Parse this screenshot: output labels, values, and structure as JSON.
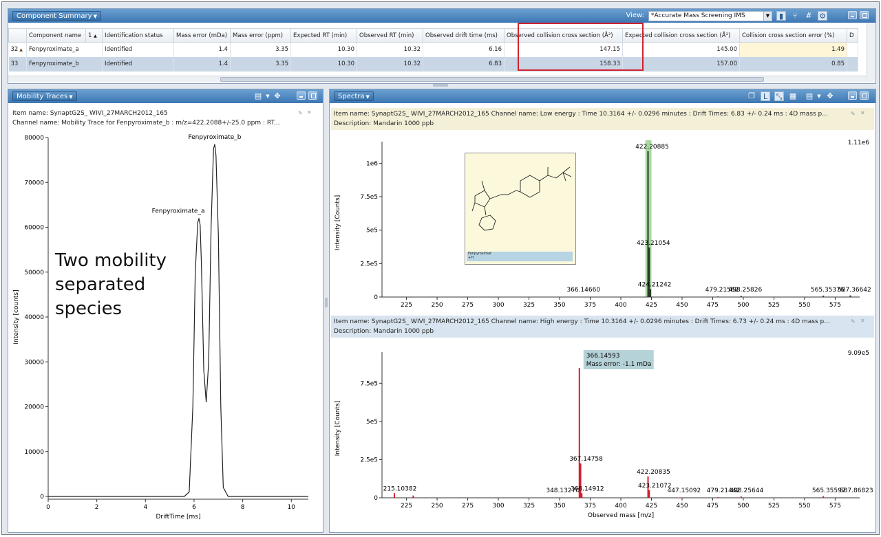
{
  "summary": {
    "title": "Component Summary",
    "view_label": "View:",
    "view_value": "*Accurate Mass Screening IMS",
    "columns": [
      "",
      "Component name",
      "1",
      "Identification status",
      "Mass error (mDa)",
      "Mass error (ppm)",
      "Expected RT (min)",
      "Observed RT (min)",
      "Observed drift time (ms)",
      "Observed collision cross section (Å²)",
      "Expected collision cross section (Å²)",
      "Collision cross section error (%)",
      "D"
    ],
    "rows": [
      {
        "index": "32",
        "name": "Fenpyroximate_a",
        "status": "Identified",
        "mass_err_mda": "1.4",
        "mass_err_ppm": "3.35",
        "exp_rt": "10.30",
        "obs_rt": "10.32",
        "drift": "6.16",
        "obs_ccs": "147.15",
        "exp_ccs": "145.00",
        "ccs_err": "1.49"
      },
      {
        "index": "33",
        "name": "Fenpyroximate_b",
        "status": "Identified",
        "mass_err_mda": "1.4",
        "mass_err_ppm": "3.35",
        "exp_rt": "10.30",
        "obs_rt": "10.32",
        "drift": "6.83",
        "obs_ccs": "158.33",
        "exp_ccs": "157.00",
        "ccs_err": "0.85"
      }
    ]
  },
  "mobility": {
    "title": "Mobility Traces",
    "item_name": "Item name: SynaptG2S_ WIVI_27MARCH2012_165",
    "channel_name": "Channel name: Mobility Trace for Fenpyroximate_b : m/z=422.2088+/-25.0 ppm : RT...",
    "callout": [
      "Two mobility",
      "separated",
      "species"
    ],
    "chart_data": {
      "type": "line",
      "xlabel": "DriftTime [ms]",
      "ylabel": "Intensity [counts]",
      "xlim": [
        0,
        10.7
      ],
      "ylim": [
        0,
        80000
      ],
      "xticks": [
        0,
        2,
        4,
        6,
        8,
        10
      ],
      "yticks": [
        0,
        10000,
        20000,
        30000,
        40000,
        50000,
        60000,
        70000,
        80000
      ],
      "x": [
        0,
        5.6,
        5.8,
        5.95,
        6.05,
        6.15,
        6.2,
        6.25,
        6.3,
        6.4,
        6.5,
        6.6,
        6.7,
        6.8,
        6.85,
        6.9,
        7.0,
        7.1,
        7.2,
        7.4,
        10.7
      ],
      "y": [
        0,
        0,
        1000,
        20000,
        50000,
        61000,
        62000,
        60500,
        52000,
        28000,
        21000,
        30000,
        60000,
        77500,
        78500,
        76000,
        58000,
        20000,
        2000,
        0,
        0
      ],
      "annotations": [
        {
          "text": "Fenpyroximate_a",
          "x": 6.2,
          "y": 62000
        },
        {
          "text": "Fenpyroximate_b",
          "x": 6.85,
          "y": 78500
        }
      ]
    }
  },
  "spectra": {
    "title": "Spectra",
    "low": {
      "item_line": "Item name: SynaptG2S_ WIVI_27MARCH2012_165   Channel name: Low energy : Time 10.3164 +/- 0.0296 minutes : Drift Times: 6.83 +/- 0.24 ms : 4D mass p...",
      "description": "Description: Mandarin 1000 ppb",
      "max_label": "1.11e6",
      "structure_caption": "Fenpyroximat",
      "structure_caption2": "+H",
      "chart_data": {
        "type": "bar",
        "ylabel": "Intensity [Counts]",
        "xlim": [
          205,
          595
        ],
        "ylim": [
          0,
          1110000
        ],
        "xticks": [
          225,
          250,
          275,
          300,
          325,
          350,
          375,
          400,
          425,
          450,
          475,
          500,
          525,
          550,
          575
        ],
        "yticks": [
          0,
          250000,
          500000,
          750000,
          1000000
        ],
        "ytick_labels": [
          "0",
          "2.5e5",
          "5e5",
          "7.5e5",
          "1e6"
        ],
        "highlight_range": [
          420,
          425
        ],
        "peaks": [
          {
            "x": 366.1466,
            "y": 2000,
            "label": "366.14660"
          },
          {
            "x": 422.20885,
            "y": 1090000,
            "label": "422.20885"
          },
          {
            "x": 423.21054,
            "y": 370000,
            "label": "423.21054"
          },
          {
            "x": 424.21242,
            "y": 60000,
            "label": "424.21242"
          },
          {
            "x": 479.21562,
            "y": 4000,
            "label": "479.21562"
          },
          {
            "x": 498.25826,
            "y": 9000,
            "label": "498.25826"
          },
          {
            "x": 565.35376,
            "y": 11000,
            "label": "565.35376"
          },
          {
            "x": 587.36642,
            "y": 12000,
            "label": "587.36642"
          }
        ]
      }
    },
    "high": {
      "item_line": "Item name: SynaptG2S_ WIVI_27MARCH2012_165  Channel name: High energy : Time 10.3164 +/- 0.0296 minutes : Drift Times: 6.73 +/- 0.24 ms : 4D mass p...",
      "description": "Description: Mandarin 1000 ppb",
      "max_label": "9.09e5",
      "tooltip_mass": "366.14593",
      "tooltip_error": "Mass error: -1.1 mDa",
      "chart_data": {
        "type": "bar",
        "xlabel": "Observed mass [m/z]",
        "ylabel": "Intensity [Counts]",
        "xlim": [
          205,
          595
        ],
        "ylim": [
          0,
          909000
        ],
        "xticks": [
          225,
          250,
          275,
          300,
          325,
          350,
          375,
          400,
          425,
          450,
          475,
          500,
          525,
          550,
          575
        ],
        "yticks": [
          0,
          250000,
          500000,
          750000
        ],
        "ytick_labels": [
          "0",
          "2.5e5",
          "5e5",
          "7.5e5"
        ],
        "peaks": [
          {
            "x": 215.10382,
            "y": 30000,
            "label": "215.10382"
          },
          {
            "x": 230.5,
            "y": 15000,
            "label": ""
          },
          {
            "x": 348.1327,
            "y": 3000,
            "label": "348.13270"
          },
          {
            "x": 366.14593,
            "y": 850000,
            "label": ""
          },
          {
            "x": 367.14758,
            "y": 225000,
            "label": "367.14758"
          },
          {
            "x": 368.14912,
            "y": 30000,
            "label": "368.14912"
          },
          {
            "x": 422.20835,
            "y": 140000,
            "label": "422.20835"
          },
          {
            "x": 423.21072,
            "y": 50000,
            "label": "423.21072"
          },
          {
            "x": 447.15092,
            "y": 2000,
            "label": "447.15092"
          },
          {
            "x": 479.21442,
            "y": 4000,
            "label": "479.21442"
          },
          {
            "x": 498.25644,
            "y": 9000,
            "label": "498.25644"
          },
          {
            "x": 565.35597,
            "y": 11000,
            "label": "565.35597"
          },
          {
            "x": 587.86823,
            "y": 2000,
            "label": "587.86823"
          }
        ]
      }
    }
  },
  "colors": {
    "header_blue": "#3d77b3",
    "peak_low": "#2a3a2a",
    "peak_high": "#d0202e",
    "highlight_green": "#a8d8a0",
    "tooltip_bg": "#b5d2d8",
    "highlight_box": "#d2202e"
  }
}
